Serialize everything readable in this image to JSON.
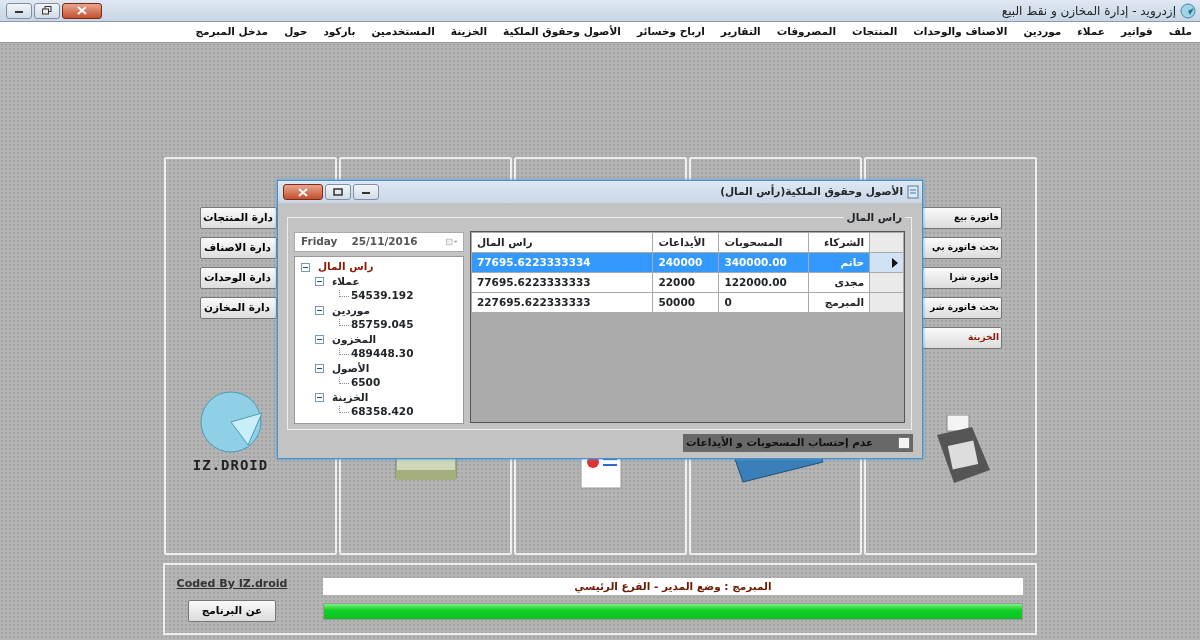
{
  "window": {
    "title": "إزدرويد - إدارة المخازن و نقط البيع"
  },
  "menu": [
    "ملف",
    "فواتير",
    "عملاء",
    "موردين",
    "الاصناف والوحدات",
    "المنتجات",
    "المصروفات",
    "التقارير",
    "ارباح وخسائر",
    "الأصول وحقوق الملكية",
    "الخزينة",
    "المستخدمين",
    "باركود",
    "حول",
    "مدخل المبرمج"
  ],
  "panels": [
    {
      "kind": "buttons-right",
      "buttons": [
        "فاتورة بيع",
        "بحث فاتورة بي",
        "فاتورة شرا",
        "بحث فاتورة شر",
        "الخزينة"
      ]
    },
    {
      "kind": "card"
    },
    {
      "kind": "report"
    },
    {
      "kind": "money"
    },
    {
      "kind": "buttons-left",
      "buttons": [
        "دارة المنتجات",
        "دارة الاصناف",
        "دارة الوحدات",
        "دارة المخازن"
      ],
      "logo": "IZ.DROID"
    }
  ],
  "footer": {
    "link": "Coded By IZ.droid",
    "about_button": "عن البرنامج",
    "status": "المبرمج : وضع المدير - الفرع الرئيسي",
    "progress": {
      "level": 1
    }
  },
  "dialog": {
    "title": "الأصول وحقوق الملكية(رأس المال)",
    "group_title": "راس المال",
    "date": {
      "day": "Friday",
      "value": "25/11/2016"
    },
    "tree": [
      {
        "label": "راس المال",
        "expanded": true,
        "children": [
          {
            "label": "عملاء",
            "expanded": true,
            "children": [
              {
                "label": "54539.192"
              }
            ]
          },
          {
            "label": "موردين",
            "expanded": true,
            "children": [
              {
                "label": "85759.045"
              }
            ]
          },
          {
            "label": "المخزون",
            "expanded": true,
            "children": [
              {
                "label": "489448.30"
              }
            ]
          },
          {
            "label": "الأصول",
            "expanded": true,
            "children": [
              {
                "label": "6500"
              }
            ]
          },
          {
            "label": "الخزينة",
            "expanded": true,
            "children": [
              {
                "label": "68358.420"
              }
            ]
          }
        ]
      }
    ],
    "table": {
      "columns": [
        "الشركاء",
        "المسحوبات",
        "الأيداعات",
        "راس المال"
      ],
      "rows": [
        {
          "cells": [
            "حاتم",
            "340000.00",
            "240000",
            "77695.6223333334"
          ],
          "selected": true
        },
        {
          "cells": [
            "مجدى",
            "122000.00",
            "22000",
            "77695.6223333333"
          ],
          "selected": false
        },
        {
          "cells": [
            "المبرمج",
            "0",
            "50000",
            "227695.622333333"
          ],
          "selected": false
        }
      ]
    },
    "checkbox": {
      "label": "عدم إحتساب المسحوبات و الأيداعات",
      "checked": false
    }
  }
}
